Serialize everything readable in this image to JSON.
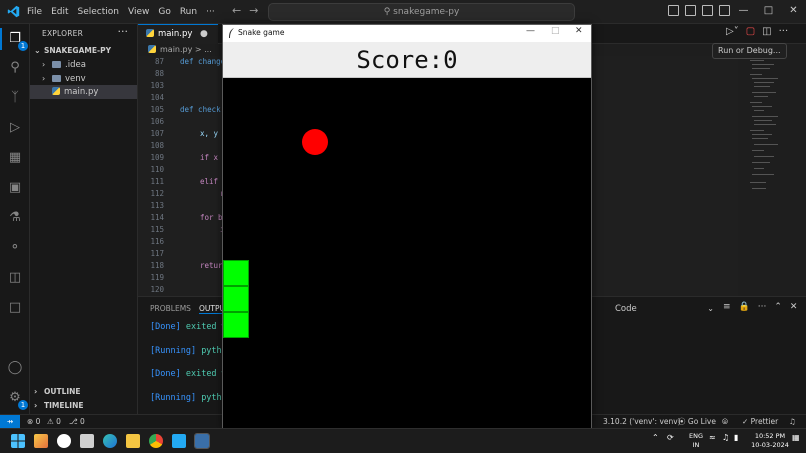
{
  "titlebar": {
    "menu": [
      "File",
      "Edit",
      "Selection",
      "View",
      "Go",
      "Run",
      "···"
    ],
    "search_text": "snakegame-py",
    "controls": [
      "—",
      "□",
      "✕"
    ]
  },
  "activity_badges": {
    "explorer": "1",
    "settings": "1"
  },
  "sidebar": {
    "header": "EXPLORER",
    "root": "SNAKEGAME-PY",
    "items": [
      {
        "label": ".idea",
        "type": "folder",
        "color": "#7b8fa8"
      },
      {
        "label": "venv",
        "type": "folder",
        "color": "#7b8fa8"
      },
      {
        "label": "main.py",
        "type": "python",
        "selected": true
      }
    ],
    "sections": [
      "OUTLINE",
      "TIMELINE"
    ]
  },
  "editor": {
    "tab_label": "main.py",
    "modified_dot": "●",
    "breadcrumb": "main.py > ...",
    "lines": [
      {
        "n": "87",
        "code": "def change"
      },
      {
        "n": "88",
        "code": ""
      },
      {
        "n": "103",
        "code": ""
      },
      {
        "n": "104",
        "code": ""
      },
      {
        "n": "105",
        "code": "def check"
      },
      {
        "n": "106",
        "code": ""
      },
      {
        "n": "107",
        "code": "x, y"
      },
      {
        "n": "108",
        "code": ""
      },
      {
        "n": "109",
        "code": "if x"
      },
      {
        "n": "110",
        "code": ""
      },
      {
        "n": "111",
        "code": "elif"
      },
      {
        "n": "112",
        "code": "r"
      },
      {
        "n": "113",
        "code": ""
      },
      {
        "n": "114",
        "code": "for b"
      },
      {
        "n": "115",
        "code": "i"
      },
      {
        "n": "116",
        "code": ""
      },
      {
        "n": "117",
        "code": ""
      },
      {
        "n": "118",
        "code": "retur"
      },
      {
        "n": "119",
        "code": ""
      },
      {
        "n": "120",
        "code": ""
      }
    ]
  },
  "tooltip": "Run or Debug...",
  "panel": {
    "tabs": [
      "PROBLEMS",
      "OUTPUT"
    ],
    "output_lines": [
      {
        "tag": "[Done]",
        "text": "exited w"
      },
      {
        "tag": "[Running]",
        "text": "pytho"
      },
      {
        "tag": "[Done]",
        "text": "exited w"
      },
      {
        "tag": "[Running]",
        "text": "pytho"
      }
    ],
    "channel": "Code"
  },
  "statusbar": {
    "errors": "⊗ 0",
    "warnings": "⚠ 0",
    "ports": "⎇ 0",
    "python": "3.10.2 ('venv': venv)",
    "golive": "⦿ Go Live",
    "prettier": "✓ Prettier"
  },
  "game": {
    "window_title": "Snake game",
    "score_text": "Score:0",
    "colors": {
      "food": "#ff0000",
      "snake": "#00ff00",
      "background": "#000000"
    }
  },
  "taskbar": {
    "lang": "ENG",
    "region": "IN",
    "time": "10:52 PM",
    "date": "10-03-2024"
  }
}
